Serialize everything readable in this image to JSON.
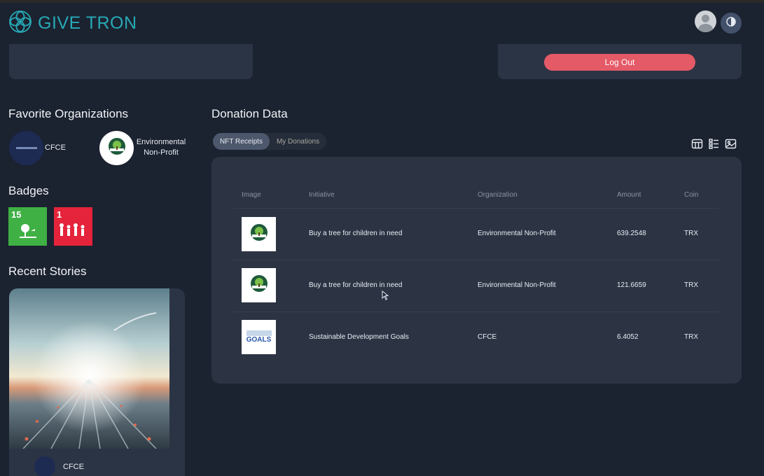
{
  "header": {
    "brand": "GIVE TRON"
  },
  "account": {
    "logout_label": "Log Out"
  },
  "favorites": {
    "title": "Favorite Organizations",
    "orgs": [
      {
        "name": "CFCE"
      },
      {
        "name_line1": "Environmental",
        "name_line2": "Non-Profit"
      }
    ]
  },
  "badges": {
    "title": "Badges",
    "items": [
      {
        "number": "15",
        "color": "#3fb044"
      },
      {
        "number": "1",
        "color": "#e5243b"
      }
    ]
  },
  "stories": {
    "title": "Recent Stories",
    "items": [
      {
        "org": "CFCE"
      }
    ]
  },
  "donation": {
    "title": "Donation Data",
    "tabs": [
      {
        "label": "NFT Receipts",
        "active": true
      },
      {
        "label": "My Donations",
        "active": false
      }
    ],
    "view_icons": [
      "card-view-icon",
      "list-view-icon",
      "image-view-icon"
    ],
    "columns": {
      "image": "Image",
      "initiative": "Initiative",
      "organization": "Organization",
      "amount": "Amount",
      "coin": "Coin"
    },
    "rows": [
      {
        "thumb": "tree-logo",
        "initiative": "Buy a tree for children in need",
        "organization": "Environmental Non-Profit",
        "amount": "639.2548",
        "coin": "TRX"
      },
      {
        "thumb": "tree-logo",
        "initiative": "Buy a tree for children in need",
        "organization": "Environmental Non-Profit",
        "amount": "121.6659",
        "coin": "TRX"
      },
      {
        "thumb": "sdg-logo",
        "thumb_text": "GOALS",
        "initiative": "Sustainable Development Goals",
        "organization": "CFCE",
        "amount": "6.4052",
        "coin": "TRX"
      }
    ]
  },
  "colors": {
    "background": "#1b2230",
    "card": "#2b3444",
    "brand": "#27a9b5",
    "logout": "#e55a67"
  }
}
